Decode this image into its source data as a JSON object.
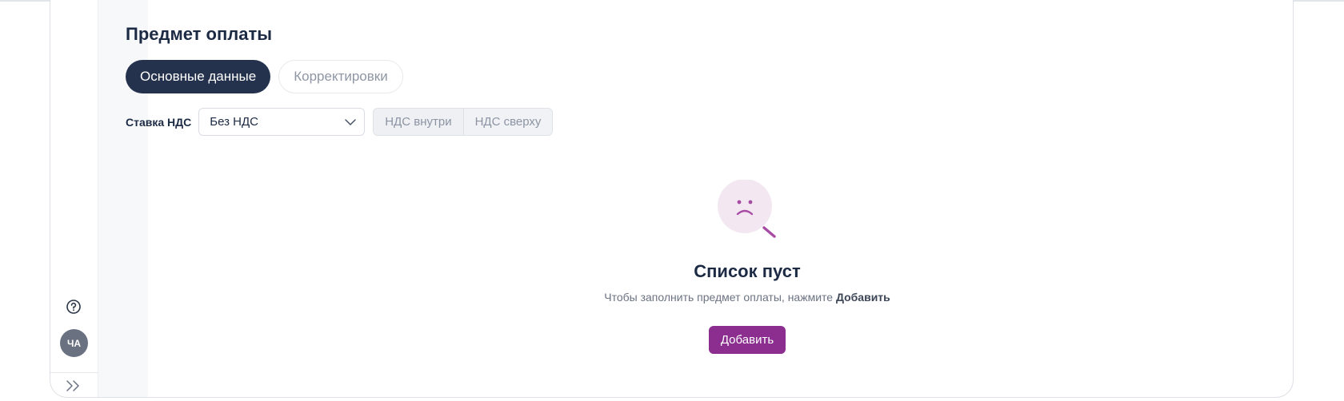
{
  "page": {
    "title": "Предмет оплаты"
  },
  "tabs": [
    {
      "label": "Основные данные",
      "active": true
    },
    {
      "label": "Корректировки",
      "active": false
    }
  ],
  "vat": {
    "label": "Ставка НДС",
    "selected": "Без НДС",
    "modes": [
      "НДС внутри",
      "НДС сверху"
    ]
  },
  "empty_state": {
    "title": "Список пуст",
    "description": "Чтобы заполнить предмет оплаты, нажмите",
    "description_action": "Добавить",
    "button": "Добавить",
    "icon": "sad-magnifier-icon"
  },
  "sidebar": {
    "help_icon": "question-circle-icon",
    "avatar_initials": "ЧА",
    "expand_icon": "double-chevron-right-icon"
  },
  "colors": {
    "primary_tab": "#25324d",
    "accent_button": "#8b2e8f",
    "avatar": "#6a7282",
    "empty_icon_bg": "#f3e8f2",
    "empty_icon_stroke": "#a64ca4"
  }
}
